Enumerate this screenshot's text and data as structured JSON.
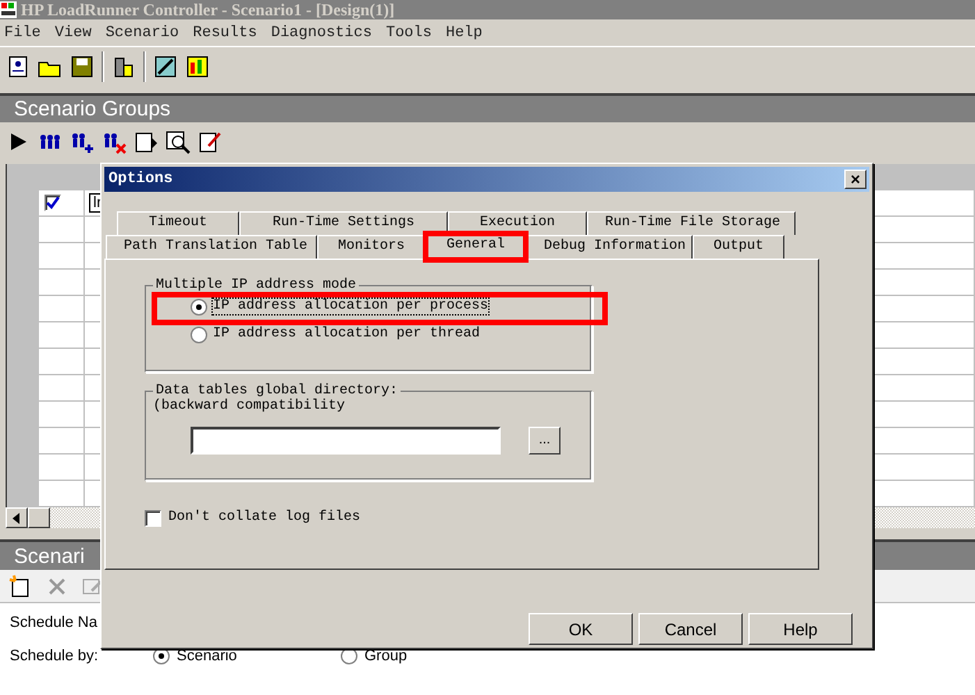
{
  "window": {
    "title": "HP LoadRunner Controller - Scenario1 - [Design(1)]"
  },
  "menu": [
    "File",
    "View",
    "Scenario",
    "Results",
    "Diagnostics",
    "Tools",
    "Help"
  ],
  "scenario_groups": {
    "title": "Scenario Groups",
    "rows": [
      {
        "checked": true,
        "text": "lr"
      }
    ]
  },
  "schedule": {
    "title": "Scenari",
    "name_label": "Schedule Na",
    "by_label": "Schedule by:",
    "by_options": [
      {
        "label": "Scenario",
        "selected": true
      },
      {
        "label": "Group",
        "selected": false
      }
    ]
  },
  "dialog": {
    "title": "Options",
    "close": "×",
    "tab_rows": [
      {
        "tabs": [
          {
            "label": "Timeout",
            "selected": false,
            "highlighted": false
          },
          {
            "label": "Run-Time Settings",
            "selected": false,
            "highlighted": false
          },
          {
            "label": "Execution",
            "selected": false,
            "highlighted": false
          },
          {
            "label": "Run-Time File Storage",
            "selected": false,
            "highlighted": false
          }
        ]
      },
      {
        "tabs": [
          {
            "label": "Path Translation Table",
            "selected": false,
            "highlighted": false
          },
          {
            "label": "Monitors",
            "selected": false,
            "highlighted": false
          },
          {
            "label": "General",
            "selected": true,
            "highlighted": true
          },
          {
            "label": "Debug Information",
            "selected": false,
            "highlighted": false
          },
          {
            "label": "Output",
            "selected": false,
            "highlighted": false
          }
        ]
      }
    ],
    "ip_mode": {
      "legend": "Multiple IP address mode",
      "options": [
        {
          "label": "IP address allocation per process",
          "selected": true,
          "highlighted": true
        },
        {
          "label": "IP address allocation per thread",
          "selected": false,
          "highlighted": false
        }
      ]
    },
    "data_tables": {
      "legend": "Data tables global directory:",
      "note": "(backward compatibility",
      "browse": "..."
    },
    "collate": {
      "label": "Don't collate log files",
      "checked": false
    },
    "buttons": [
      "OK",
      "Cancel",
      "Help"
    ]
  }
}
